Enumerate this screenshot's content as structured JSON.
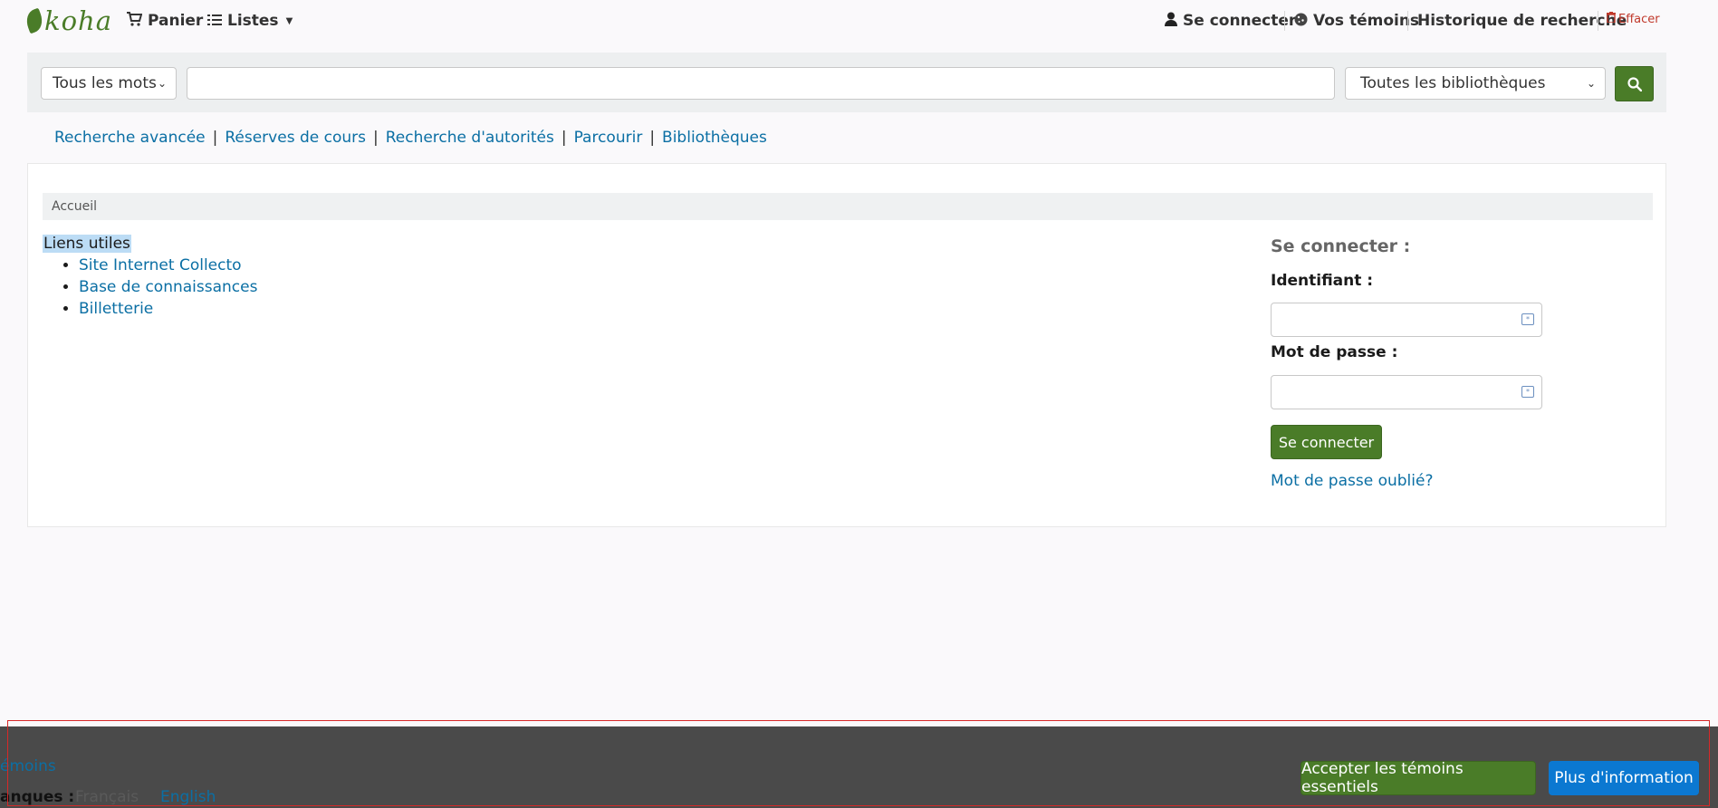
{
  "header": {
    "logo_text": "koha",
    "cart_label": "Panier",
    "lists_label": "Listes",
    "login_label": "Se connecter",
    "cookies_label": "Vos témoins",
    "history_label": "Historique de recherche",
    "clear_label": "Effacer"
  },
  "search": {
    "type_selected": "Tous les mots",
    "query_value": "",
    "library_selected": "Toutes les bibliothèques"
  },
  "links": {
    "items": [
      "Recherche avancée",
      "Réserves de cours",
      "Recherche d'autorités",
      "Parcourir",
      "Bibliothèques"
    ]
  },
  "breadcrumb": {
    "home": "Accueil"
  },
  "useful_links": {
    "title": "Liens utiles",
    "items": [
      "Site Internet Collecto",
      "Base de connaissances",
      "Billetterie"
    ]
  },
  "login": {
    "title": "Se connecter :",
    "username_label": "Identifiant :",
    "username_value": "",
    "password_label": "Mot de passe :",
    "password_value": "",
    "submit_label": "Se connecter",
    "forgot_label": "Mot de passe oublié?"
  },
  "cookie_banner": {
    "partial_text": "émoins",
    "languages_label": "anques :",
    "lang_fr": "Français",
    "lang_en": "English",
    "accept_label": "Accepter les témoins essentiels",
    "info_label": "Plus d'information"
  },
  "colors": {
    "brand_green": "#4a7c28",
    "link_blue": "#0b6fa4",
    "info_blue": "#0b78d1",
    "banner_bg": "#4a4a4a",
    "alert_red": "#d62828"
  }
}
